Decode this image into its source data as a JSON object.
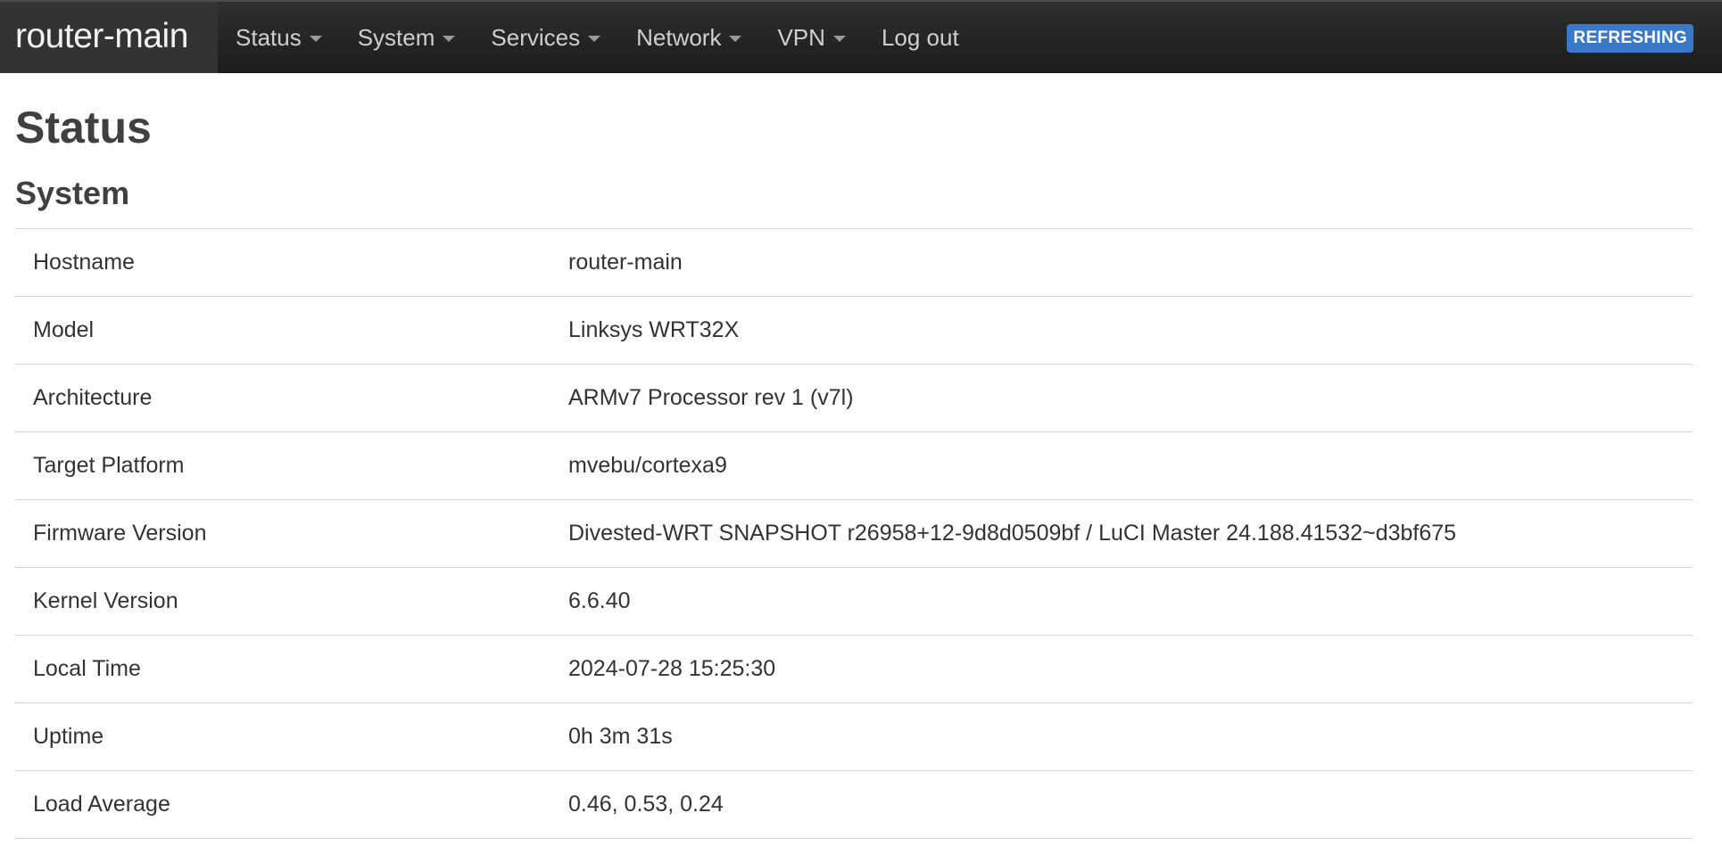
{
  "header": {
    "brand": "router-main",
    "menu": [
      {
        "label": "Status",
        "dropdown": true
      },
      {
        "label": "System",
        "dropdown": true
      },
      {
        "label": "Services",
        "dropdown": true
      },
      {
        "label": "Network",
        "dropdown": true
      },
      {
        "label": "VPN",
        "dropdown": true
      },
      {
        "label": "Log out",
        "dropdown": false
      }
    ],
    "badge": "REFRESHING",
    "badge_color": "#3a78c9"
  },
  "page": {
    "title": "Status",
    "section_title": "System"
  },
  "system": {
    "rows": [
      {
        "key": "Hostname",
        "value": "router-main"
      },
      {
        "key": "Model",
        "value": "Linksys WRT32X"
      },
      {
        "key": "Architecture",
        "value": "ARMv7 Processor rev 1 (v7l)"
      },
      {
        "key": "Target Platform",
        "value": "mvebu/cortexa9"
      },
      {
        "key": "Firmware Version",
        "value": "Divested-WRT SNAPSHOT r26958+12-9d8d0509bf / LuCI Master 24.188.41532~d3bf675"
      },
      {
        "key": "Kernel Version",
        "value": "6.6.40"
      },
      {
        "key": "Local Time",
        "value": "2024-07-28 15:25:30"
      },
      {
        "key": "Uptime",
        "value": "0h 3m 31s"
      },
      {
        "key": "Load Average",
        "value": "0.46, 0.53, 0.24"
      }
    ]
  }
}
